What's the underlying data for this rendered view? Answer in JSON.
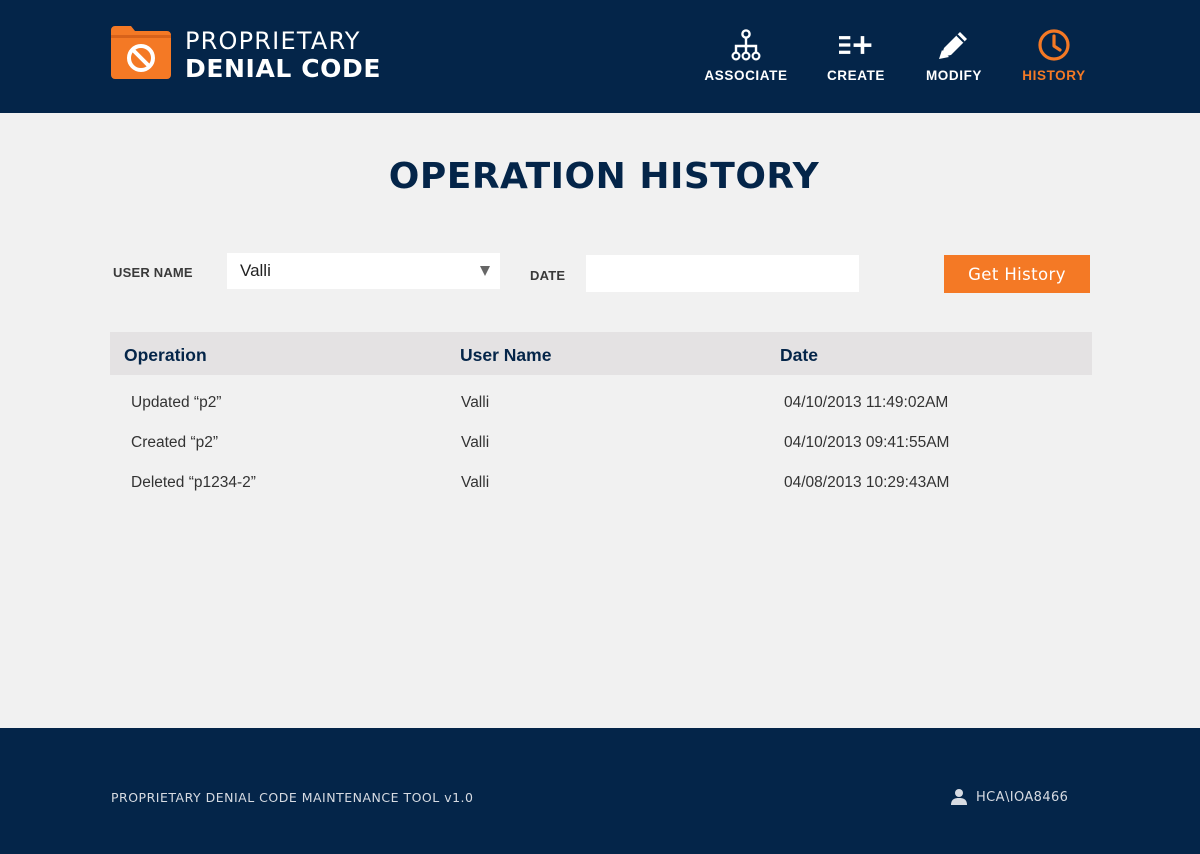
{
  "brand": {
    "line1": "PROPRIETARY",
    "line2": "DENIAL CODE",
    "icon": "folder-prohibited-icon",
    "accent_color": "#f47925"
  },
  "nav": {
    "items": [
      {
        "label": "ASSOCIATE",
        "icon": "hierarchy-icon",
        "active": false
      },
      {
        "label": "CREATE",
        "icon": "list-add-icon",
        "active": false
      },
      {
        "label": "MODIFY",
        "icon": "pencil-icon",
        "active": false
      },
      {
        "label": "HISTORY",
        "icon": "clock-icon",
        "active": true
      }
    ]
  },
  "page": {
    "title": "OPERATION HISTORY"
  },
  "filters": {
    "user_label": "USER NAME",
    "user_value": "Valli",
    "date_label": "DATE",
    "date_value": "",
    "button_label": "Get History"
  },
  "table": {
    "columns": [
      "Operation",
      "User Name",
      "Date"
    ],
    "rows": [
      [
        "Updated “p2”",
        "Valli",
        "04/10/2013 11:49:02AM"
      ],
      [
        "Created “p2”",
        "Valli",
        "04/10/2013 09:41:55AM"
      ],
      [
        "Deleted “p1234-2”",
        "Valli",
        "04/08/2013 10:29:43AM"
      ]
    ]
  },
  "footer": {
    "tool_name": "PROPRIETARY DENIAL CODE MAINTENANCE TOOL v1.0",
    "user_icon": "user-icon",
    "user": "HCA\\IOA8466"
  },
  "colors": {
    "navy": "#042549",
    "orange": "#f47925",
    "background": "#f1f1f1",
    "table_header": "#e4e2e3"
  }
}
